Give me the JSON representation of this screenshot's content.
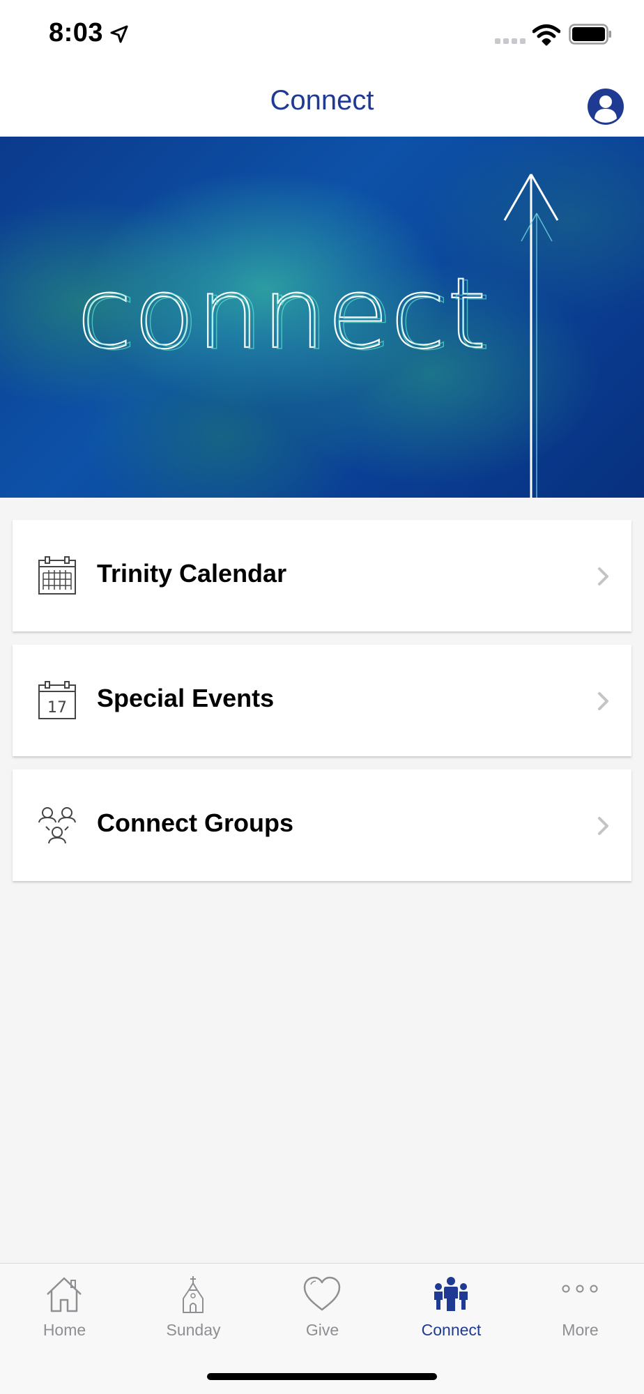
{
  "status_bar": {
    "time": "8:03",
    "icons": [
      "location-arrow-icon",
      "cellular-signal-icon",
      "wifi-icon",
      "battery-icon"
    ]
  },
  "nav": {
    "title": "Connect",
    "profile_icon": "user-circle-icon"
  },
  "hero": {
    "text": "connect"
  },
  "menu": [
    {
      "label": "Trinity Calendar",
      "icon": "calendar-grid-icon"
    },
    {
      "label": "Special Events",
      "icon": "calendar-date-icon",
      "icon_text": "17"
    },
    {
      "label": "Connect Groups",
      "icon": "group-people-icon"
    }
  ],
  "tab_bar": {
    "items": [
      {
        "label": "Home",
        "icon": "home-icon"
      },
      {
        "label": "Sunday",
        "icon": "church-icon"
      },
      {
        "label": "Give",
        "icon": "heart-icon"
      },
      {
        "label": "Connect",
        "icon": "people-icon",
        "active": true
      },
      {
        "label": "More",
        "icon": "more-dots-icon"
      }
    ]
  },
  "colors": {
    "accent": "#1f3a93",
    "inactive": "#8e8e93",
    "background": "#f5f5f5"
  }
}
